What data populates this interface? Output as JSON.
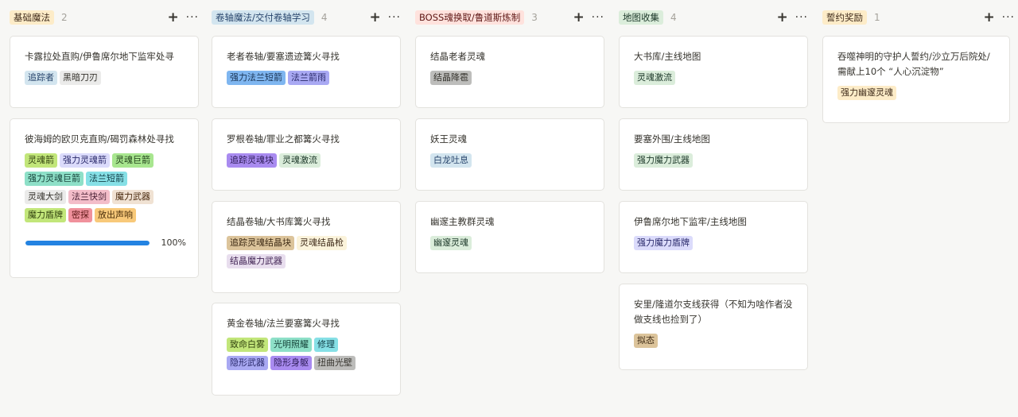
{
  "colors": {
    "blue": {
      "bg": "#d3e5ef",
      "fg": "#28456c"
    },
    "gray": {
      "bg": "#ebebea",
      "fg": "#37352f"
    },
    "darkgray": {
      "bg": "#bdbdbb",
      "fg": "#37352f"
    },
    "strongblue": {
      "bg": "#7fb6f0",
      "fg": "#1a3455"
    },
    "indigo": {
      "bg": "#a9a9f3",
      "fg": "#2a2a6b"
    },
    "purple": {
      "bg": "#a98bf0",
      "fg": "#2d1c57"
    },
    "lavender": {
      "bg": "#e8deee",
      "fg": "#412454"
    },
    "mint": {
      "bg": "#dbeddb",
      "fg": "#1c3829"
    },
    "teal": {
      "bg": "#8ee0c8",
      "fg": "#16433a"
    },
    "cyan": {
      "bg": "#86e0e6",
      "fg": "#14414a"
    },
    "lime": {
      "bg": "#c2e67a",
      "fg": "#334410"
    },
    "green": {
      "bg": "#a8e68f",
      "fg": "#21401a"
    },
    "lightyellow": {
      "bg": "#fbf3db",
      "fg": "#402c1b"
    },
    "yellow": {
      "bg": "#fdecc8",
      "fg": "#402c1b"
    },
    "orange": {
      "bg": "#f8c97a",
      "fg": "#4a2e0a"
    },
    "brown": {
      "bg": "#e2c7a2",
      "fg": "#442a1e"
    },
    "tan": {
      "bg": "#dcc49b",
      "fg": "#3d2a14"
    },
    "peach": {
      "bg": "#f0e2d3",
      "fg": "#49290e"
    },
    "pink": {
      "bg": "#f3bdc9",
      "fg": "#4c2337"
    },
    "red": {
      "bg": "#f0919c",
      "fg": "#5d1715"
    },
    "strongindigo": {
      "bg": "#c9c9f8",
      "fg": "#2a2a6b"
    },
    "periwinkle": {
      "bg": "#dbdbfb",
      "fg": "#2a2a6b"
    },
    "progress": "#2383e2"
  },
  "columns": [
    {
      "title": "基础魔法",
      "count": "2",
      "title_bg": "#fdecc8",
      "title_fg": "#402c1b",
      "cards": [
        {
          "title": "卡露拉处直购/伊鲁席尔地下监牢处寻",
          "tags": [
            {
              "label": "追踪者",
              "color": "blue"
            },
            {
              "label": "黑暗刀刃",
              "color": "gray"
            }
          ]
        },
        {
          "title": "彼海姆的欧贝克直购/碣罚森林处寻找",
          "tags": [
            {
              "label": "灵魂箭",
              "color": "lime"
            },
            {
              "label": "强力灵魂箭",
              "color": "periwinkle"
            },
            {
              "label": "灵魂巨箭",
              "color": "green"
            },
            {
              "label": "强力灵魂巨箭",
              "color": "teal"
            },
            {
              "label": "法兰短箭",
              "color": "cyan"
            },
            {
              "label": "灵魂大剑",
              "color": "gray"
            },
            {
              "label": "法兰快剑",
              "color": "pink"
            },
            {
              "label": "魔力武器",
              "color": "peach"
            },
            {
              "label": "魔力盾牌",
              "color": "lime"
            },
            {
              "label": "密探",
              "color": "red"
            },
            {
              "label": "放出声响",
              "color": "orange"
            }
          ],
          "progress": 1.0,
          "progress_label": "100%"
        }
      ]
    },
    {
      "title": "卷轴魔法/交付卷轴学习",
      "count": "4",
      "title_bg": "#d3e5ef",
      "title_fg": "#28456c",
      "cards": [
        {
          "title": "老者卷轴/要塞遗迹篝火寻找",
          "tags": [
            {
              "label": "强力法兰短箭",
              "color": "strongblue"
            },
            {
              "label": "法兰箭雨",
              "color": "indigo"
            }
          ]
        },
        {
          "title": "罗根卷轴/罪业之都篝火寻找",
          "tags": [
            {
              "label": "追踪灵魂块",
              "color": "purple"
            },
            {
              "label": "灵魂激流",
              "color": "mint"
            }
          ]
        },
        {
          "title": "结晶卷轴/大书库篝火寻找",
          "tags": [
            {
              "label": "追踪灵魂结晶块",
              "color": "tan"
            },
            {
              "label": "灵魂结晶枪",
              "color": "lightyellow"
            },
            {
              "label": "结晶魔力武器",
              "color": "lavender"
            }
          ]
        },
        {
          "title": "黄金卷轴/法兰要塞篝火寻找",
          "tags": [
            {
              "label": "致命白雾",
              "color": "lime"
            },
            {
              "label": "光明照耀",
              "color": "teal"
            },
            {
              "label": "修理",
              "color": "cyan"
            },
            {
              "label": "隐形武器",
              "color": "indigo"
            },
            {
              "label": "隐形身躯",
              "color": "purple"
            },
            {
              "label": "扭曲光壁",
              "color": "darkgray"
            }
          ]
        }
      ]
    },
    {
      "title": "BOSS魂换取/鲁道斯炼制",
      "count": "3",
      "title_bg": "#ffe2dd",
      "title_fg": "#5d1715",
      "cards": [
        {
          "title": "结晶老者灵魂",
          "tags": [
            {
              "label": "结晶降雹",
              "color": "darkgray"
            }
          ]
        },
        {
          "title": "妖王灵魂",
          "tags": [
            {
              "label": "白龙吐息",
              "color": "blue"
            }
          ]
        },
        {
          "title": "幽邃主教群灵魂",
          "tags": [
            {
              "label": "幽邃灵魂",
              "color": "mint"
            }
          ]
        }
      ]
    },
    {
      "title": "地图收集",
      "count": "4",
      "title_bg": "#dbeddb",
      "title_fg": "#1c3829",
      "cards": [
        {
          "title": "大书库/主线地图",
          "tags": [
            {
              "label": "灵魂激流",
              "color": "mint"
            }
          ]
        },
        {
          "title": "要塞外围/主线地图",
          "tags": [
            {
              "label": "强力魔力武器",
              "color": "mint"
            }
          ]
        },
        {
          "title": "伊鲁席尔地下监牢/主线地图",
          "tags": [
            {
              "label": "强力魔力盾牌",
              "color": "periwinkle"
            }
          ]
        },
        {
          "title": "安里/隆道尔支线获得（不知为啥作者没做支线也捡到了）",
          "tags": [
            {
              "label": "拟态",
              "color": "tan"
            }
          ]
        }
      ]
    },
    {
      "title": "誓约奖励",
      "count": "1",
      "title_bg": "#fdecc8",
      "title_fg": "#402c1b",
      "cards": [
        {
          "title": "吞噬神明的守护人誓约/沙立万后院处/需献上10个 “人心沉淀物”",
          "tags": [
            {
              "label": "强力幽邃灵魂",
              "color": "yellow"
            }
          ]
        }
      ]
    }
  ],
  "icons": {
    "add": "+",
    "more": "···"
  }
}
